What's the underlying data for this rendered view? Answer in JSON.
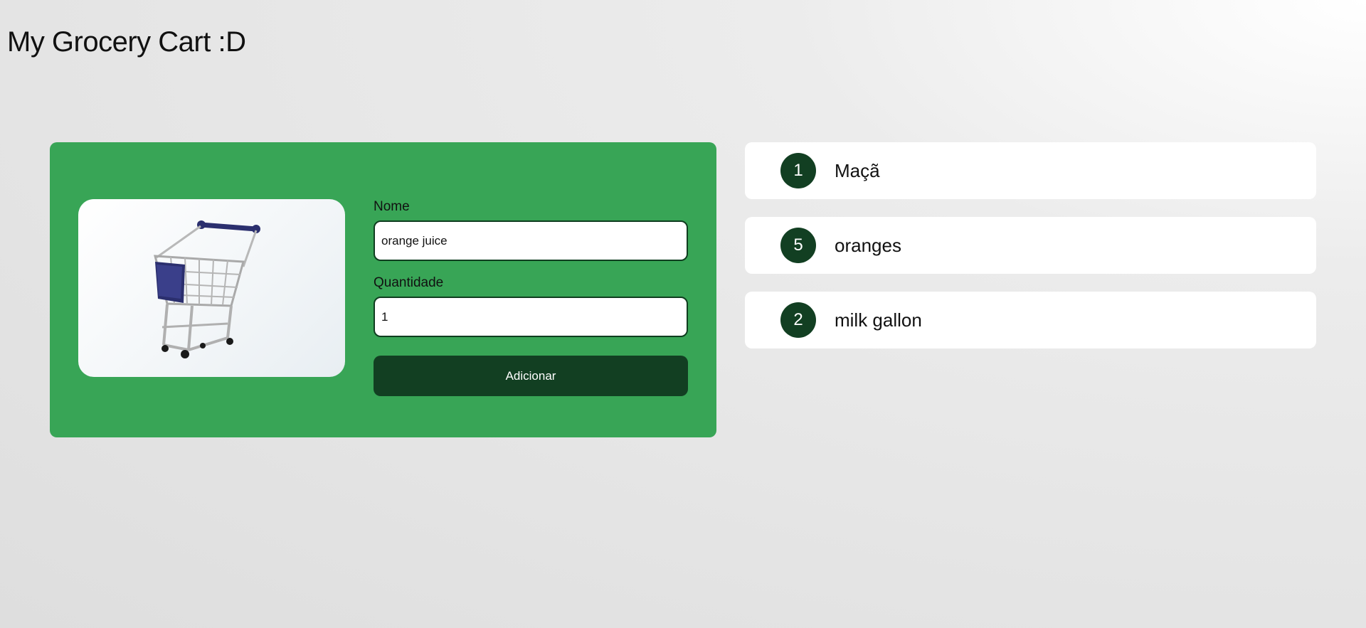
{
  "header": {
    "title": "My Grocery Cart :D"
  },
  "form": {
    "image_icon": "shopping-cart-icon",
    "name_label": "Nome",
    "name_value": "orange juice",
    "quantity_label": "Quantidade",
    "quantity_value": "1",
    "submit_label": "Adicionar"
  },
  "items": [
    {
      "quantity": "1",
      "name": "Maçã"
    },
    {
      "quantity": "5",
      "name": "oranges"
    },
    {
      "quantity": "2",
      "name": "milk gallon"
    }
  ],
  "colors": {
    "panel_green": "#38a556",
    "dark_green": "#123f22",
    "card_white": "#ffffff"
  }
}
